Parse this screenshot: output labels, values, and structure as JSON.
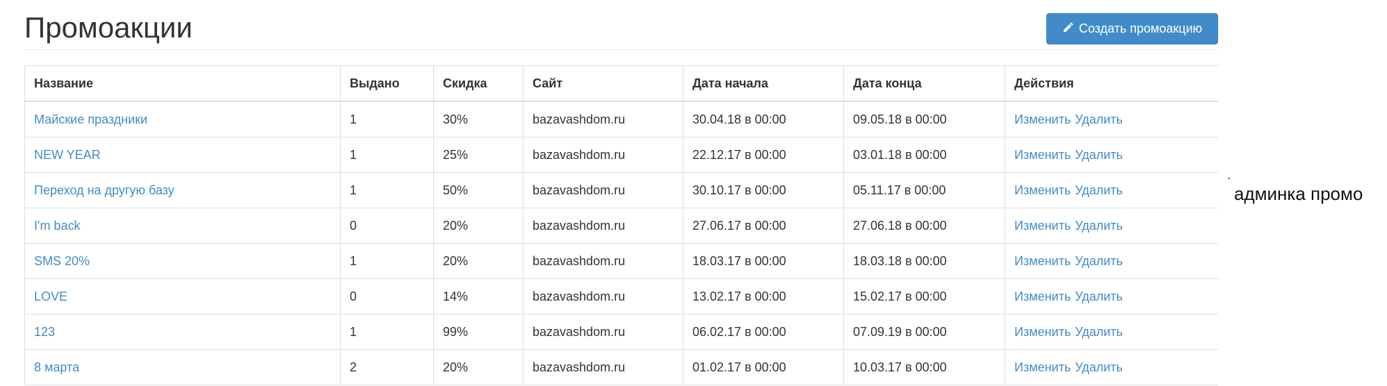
{
  "header": {
    "title": "Промоакции",
    "create_button_label": "Создать промоакцию",
    "create_button_icon": "pencil-icon"
  },
  "table": {
    "columns": [
      "Название",
      "Выдано",
      "Скидка",
      "Сайт",
      "Дата начала",
      "Дата конца",
      "Действия"
    ],
    "rows": [
      {
        "name": "Майские праздники",
        "issued": "1",
        "discount": "30%",
        "site": "bazavashdom.ru",
        "start": "30.04.18 в 00:00",
        "end": "09.05.18 в 00:00",
        "edit": "Изменить",
        "delete": "Удалить"
      },
      {
        "name": "NEW YEAR",
        "issued": "1",
        "discount": "25%",
        "site": "bazavashdom.ru",
        "start": "22.12.17 в 00:00",
        "end": "03.01.18 в 00:00",
        "edit": "Изменить",
        "delete": "Удалить"
      },
      {
        "name": "Переход на другую базу",
        "issued": "1",
        "discount": "50%",
        "site": "bazavashdom.ru",
        "start": "30.10.17 в 00:00",
        "end": "05.11.17 в 00:00",
        "edit": "Изменить",
        "delete": "Удалить"
      },
      {
        "name": "I'm back",
        "issued": "0",
        "discount": "20%",
        "site": "bazavashdom.ru",
        "start": "27.06.17 в 00:00",
        "end": "27.06.18 в 00:00",
        "edit": "Изменить",
        "delete": "Удалить"
      },
      {
        "name": "SMS 20%",
        "issued": "1",
        "discount": "20%",
        "site": "bazavashdom.ru",
        "start": "18.03.17 в 00:00",
        "end": "18.03.18 в 00:00",
        "edit": "Изменить",
        "delete": "Удалить"
      },
      {
        "name": "LOVE",
        "issued": "0",
        "discount": "14%",
        "site": "bazavashdom.ru",
        "start": "13.02.17 в 00:00",
        "end": "15.02.17 в 00:00",
        "edit": "Изменить",
        "delete": "Удалить"
      },
      {
        "name": "123",
        "issued": "1",
        "discount": "99%",
        "site": "bazavashdom.ru",
        "start": "06.02.17 в 00:00",
        "end": "07.09.19 в 00:00",
        "edit": "Изменить",
        "delete": "Удалить"
      },
      {
        "name": "8 марта",
        "issued": "2",
        "discount": "20%",
        "site": "bazavashdom.ru",
        "start": "01.02.17 в 00:00",
        "end": "10.03.17 в 00:00",
        "edit": "Изменить",
        "delete": "Удалить"
      }
    ]
  },
  "side_note": "админка промо",
  "colors": {
    "link": "#428bca",
    "button_bg": "#428bca",
    "border": "#dddddd",
    "text": "#333333"
  }
}
